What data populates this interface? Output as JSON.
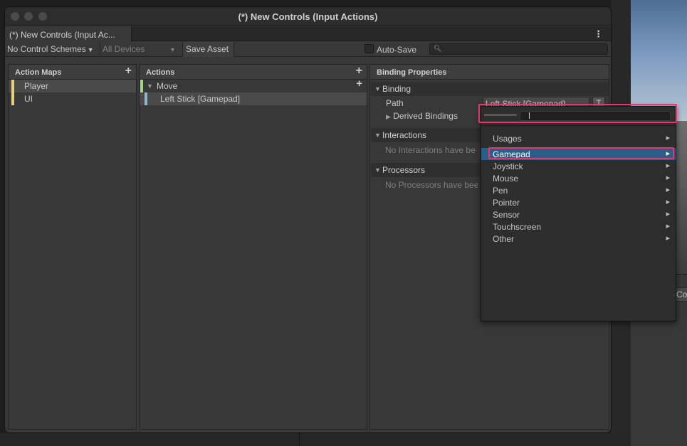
{
  "window": {
    "title": "(*) New Controls (Input Actions)",
    "tab_label": "(*) New Controls (Input Ac..."
  },
  "toolbar": {
    "control_schemes": "No Control Schemes",
    "devices": "All Devices",
    "save_asset": "Save Asset",
    "auto_save": "Auto-Save",
    "search_placeholder": ""
  },
  "action_maps": {
    "header": "Action Maps",
    "items": [
      {
        "label": "Player",
        "selected": true
      },
      {
        "label": "UI",
        "selected": false
      }
    ]
  },
  "actions": {
    "header": "Actions",
    "action": "Move",
    "binding": "Left Stick [Gamepad]"
  },
  "binding_properties": {
    "header": "Binding Properties",
    "binding_section": "Binding",
    "path_label": "Path",
    "path_value": "Left Stick [Gamepad]",
    "t_button": "T",
    "derived_bindings": "Derived Bindings",
    "interactions_section": "Interactions",
    "interactions_empty": "No Interactions have be",
    "processors_section": "Processors",
    "processors_empty": "No Processors have bee"
  },
  "popup": {
    "items": [
      {
        "label": "Usages"
      },
      {
        "label": "Gamepad",
        "selected": true
      },
      {
        "label": "Joystick"
      },
      {
        "label": "Mouse"
      },
      {
        "label": "Pen"
      },
      {
        "label": "Pointer"
      },
      {
        "label": "Sensor"
      },
      {
        "label": "Touchscreen"
      },
      {
        "label": "Other"
      }
    ]
  },
  "background": {
    "panel_button": "Col"
  },
  "colors": {
    "map_strip": "#e8d17a",
    "action_strip": "#a6d183",
    "binding_strip": "#8fb7c9",
    "selection": "#2c5d87",
    "highlight": "#e8366b"
  }
}
